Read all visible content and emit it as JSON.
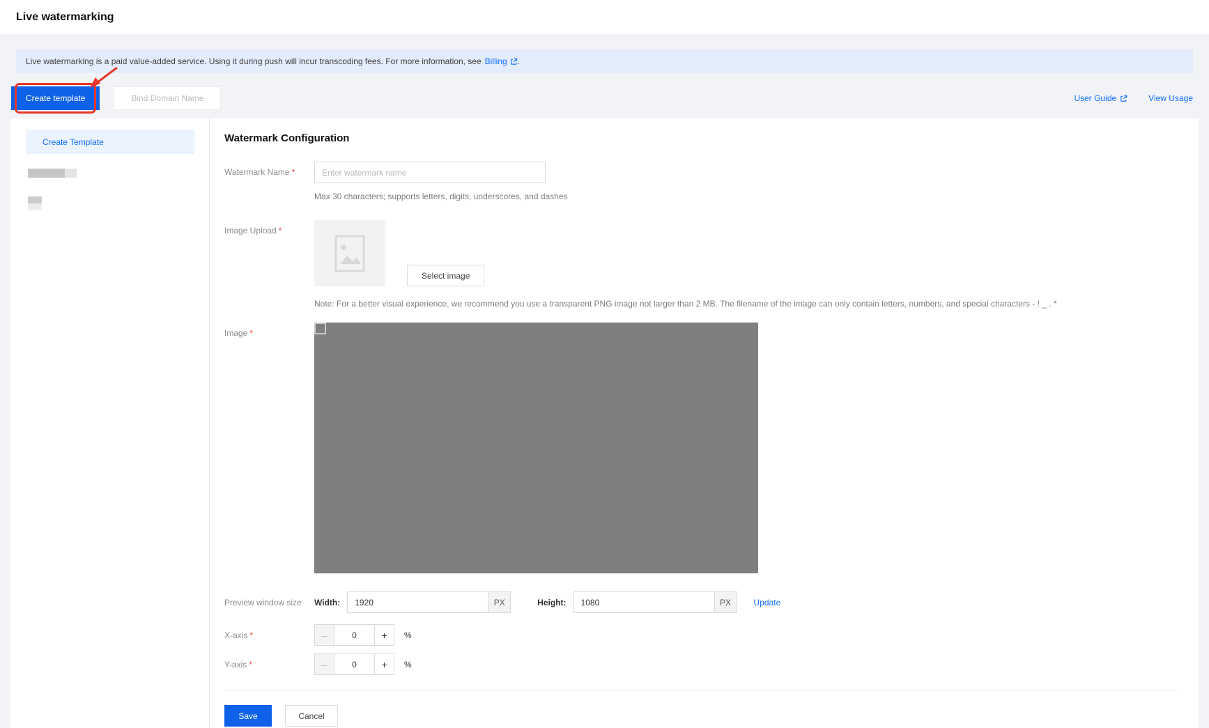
{
  "colors": {
    "accent_link": "#0e6eff",
    "primary_button": "#0f62e8",
    "annotation_red": "#e8372c",
    "banner_bg": "#e3ecfb",
    "page_bg": "#f2f3f7",
    "preview_gray": "#7f7f7f",
    "sidebar_active_bg": "#ebf3ff"
  },
  "header": {
    "title": "Live watermarking"
  },
  "banner": {
    "text": "Live watermarking is a paid value-added service. Using it during push will incur transcoding fees. For more information, see",
    "link_label": "Billing",
    "suffix": "."
  },
  "toolbar": {
    "create_template_label": "Create template",
    "bind_domain_label": "Bind Domain Name",
    "user_guide_label": "User Guide",
    "view_usage_label": "View Usage"
  },
  "sidebar": {
    "active_item": "Create Template"
  },
  "form": {
    "heading": "Watermark Configuration",
    "required_marker": "*",
    "watermark_name": {
      "label": "Watermark Name",
      "placeholder": "Enter watermark name",
      "help": "Max 30 characters; supports letters, digits, underscores, and dashes"
    },
    "image_upload": {
      "label": "Image Upload",
      "select_button_label": "Select image",
      "note": "Note: For a better visual experience, we recommend you use a transparent PNG image not larger than 2 MB. The filename of the image can only contain letters, numbers, and special characters - ! _ . *"
    },
    "image": {
      "label": "Image"
    },
    "preview_size": {
      "label": "Preview window size",
      "width_label": "Width:",
      "width_value": "1920",
      "height_label": "Height:",
      "height_value": "1080",
      "unit": "PX",
      "update_label": "Update"
    },
    "x_axis": {
      "label": "X-axis",
      "value": "0",
      "unit": "%"
    },
    "y_axis": {
      "label": "Y-axis",
      "value": "0",
      "unit": "%"
    },
    "stepper": {
      "minus_glyph": "–",
      "plus_glyph": "+"
    },
    "actions": {
      "save_label": "Save",
      "cancel_label": "Cancel"
    }
  }
}
